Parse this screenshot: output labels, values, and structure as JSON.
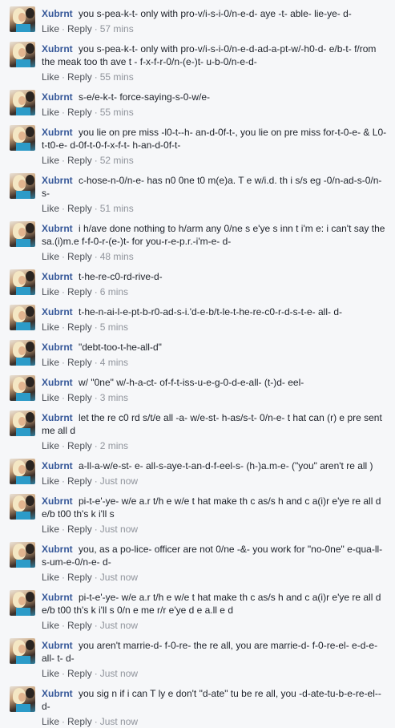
{
  "separator": "·",
  "comments": [
    {
      "author": "Xubrnt",
      "text": "you s-pea-k-t- only with pro-v/i-s-i-0/n-e-d- aye -t- able- lie-ye- d-",
      "like": "Like",
      "reply": "Reply",
      "time": "57 mins"
    },
    {
      "author": "Xubrnt",
      "text": "you s-pea-k-t- only with pro-v/i-s-i-0/n-e-d-ad-a-pt-w/-h0-d- e/b-t- f/rom the meak too th ave t - f-x-f-r-0/n-(e-)t- u-b-0/n-e-d-",
      "like": "Like",
      "reply": "Reply",
      "time": "55 mins"
    },
    {
      "author": "Xubrnt",
      "text": "s-e/e-k-t- force-saying-s-0-w/e-",
      "like": "Like",
      "reply": "Reply",
      "time": "55 mins"
    },
    {
      "author": "Xubrnt",
      "text": "you lie on pre miss -l0-t--h- an-d-0f-t-, you lie on pre miss for-t-0-e- & L0-t-t0-e- d-0f-t-0-f-x-f-t- h-an-d-0f-t-",
      "like": "Like",
      "reply": "Reply",
      "time": "52 mins"
    },
    {
      "author": "Xubrnt",
      "text": "c-hose-n-0/n-e- has n0 0ne t0 m(e)a. T e w/i.d. th i s/s eg -0/n-ad-s-0/n-s-",
      "like": "Like",
      "reply": "Reply",
      "time": "51 mins"
    },
    {
      "author": "Xubrnt",
      "text": "i h/ave done nothing to h/arm any 0/ne s e'ye s inn t i'm e: i can't say the sa.(i)m.e f-f-0-r-(e-)t- for you-r-e-p.r.-i'm-e- d-",
      "like": "Like",
      "reply": "Reply",
      "time": "48 mins"
    },
    {
      "author": "Xubrnt",
      "text": "t-he-re-c0-rd-rive-d-",
      "like": "Like",
      "reply": "Reply",
      "time": "6 mins"
    },
    {
      "author": "Xubrnt",
      "text": "t-he-n-ai-l-e-pt-b-r0-ad-s-i.'d-e-b/t-le-t-he-re-c0-r-d-s-t-e- all- d-",
      "like": "Like",
      "reply": "Reply",
      "time": "5 mins"
    },
    {
      "author": "Xubrnt",
      "text": "\"debt-too-t-he-all-d\"",
      "like": "Like",
      "reply": "Reply",
      "time": "4 mins"
    },
    {
      "author": "Xubrnt",
      "text": "w/ \"0ne\" w/-h-a-ct- of-f-t-iss-u-e-g-0-d-e-all- (t-)d- eel-",
      "like": "Like",
      "reply": "Reply",
      "time": "3 mins"
    },
    {
      "author": "Xubrnt",
      "text": "let the re c0 rd s/t/e all -a- w/e-st- h-as/s-t- 0/n-e- t hat can (r) e pre sent me all d",
      "like": "Like",
      "reply": "Reply",
      "time": "2 mins"
    },
    {
      "author": "Xubrnt",
      "text": "a-ll-a-w/e-st- e- all-s-aye-t-an-d-f-eel-s- (h-)a.m-e- (\"you\" aren't re all )",
      "like": "Like",
      "reply": "Reply",
      "time": "Just now"
    },
    {
      "author": "Xubrnt",
      "text": "pi-t-e'-ye- w/e a.r t/h e w/e t hat make th c as/s h and c a(i)r e'ye re all d e/b t00 th's k i'll s",
      "like": "Like",
      "reply": "Reply",
      "time": "Just now"
    },
    {
      "author": "Xubrnt",
      "text": "you, as a po-lice- officer are not 0/ne -&- you work for \"no-0ne\" e-qua-ll-s-um-e-0/n-e- d-",
      "like": "Like",
      "reply": "Reply",
      "time": "Just now"
    },
    {
      "author": "Xubrnt",
      "text": "pi-t-e'-ye- w/e a.r t/h e w/e t hat make th c as/s h and c a(i)r e'ye re all d e/b t00 th's k i'll s 0/n e me r/r e'ye d e a.ll e d",
      "like": "Like",
      "reply": "Reply",
      "time": "Just now"
    },
    {
      "author": "Xubrnt",
      "text": "you aren't marrie-d- f-0-re- the re all, you are marrie-d- f-0-re-el- e-d-e-all- t- d-",
      "like": "Like",
      "reply": "Reply",
      "time": "Just now"
    },
    {
      "author": "Xubrnt",
      "text": "you sig n if i can T ly e don't \"d-ate\" tu be re all, you -d-ate-tu-b-e-re-el-- d-",
      "like": "Like",
      "reply": "Reply",
      "time": "Just now"
    }
  ]
}
